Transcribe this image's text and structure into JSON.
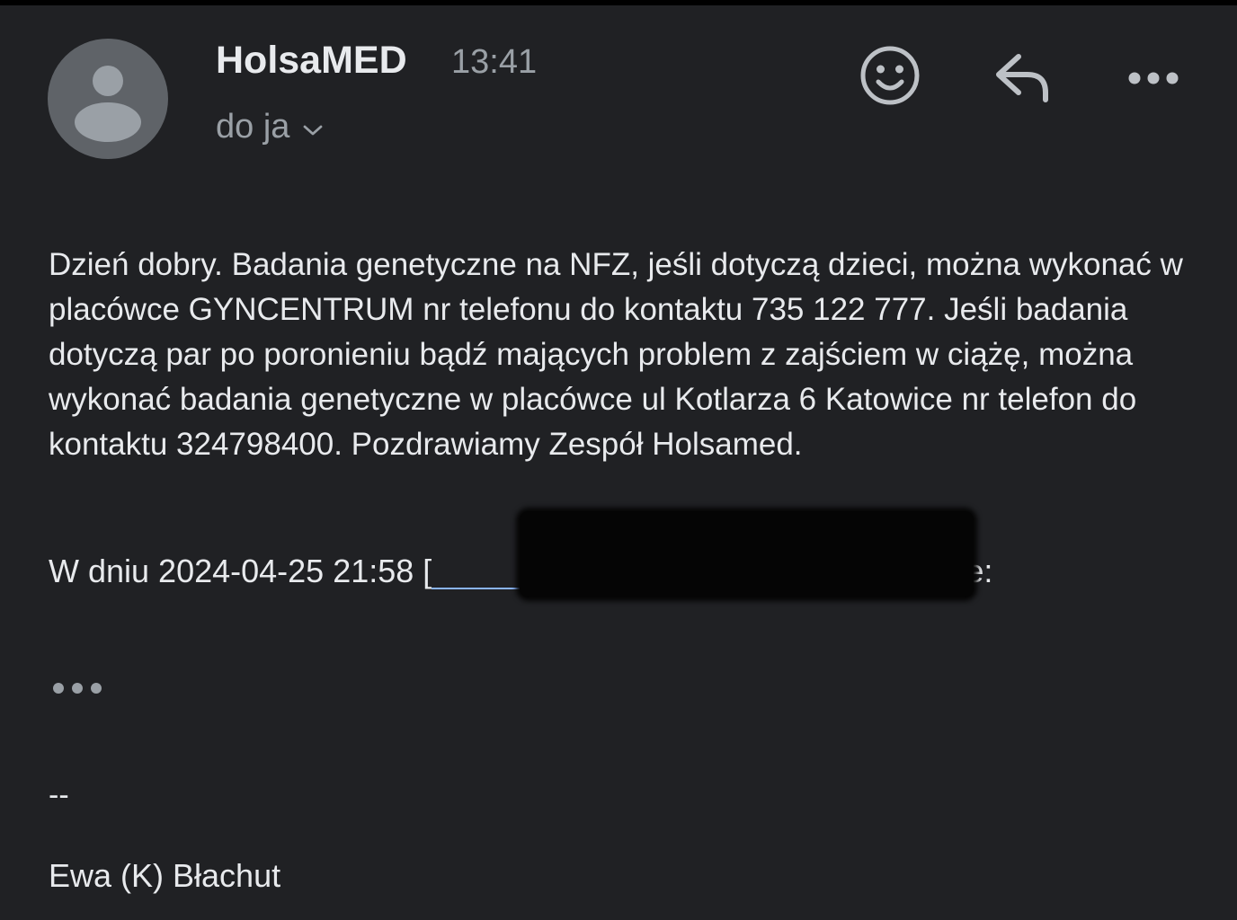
{
  "header": {
    "sender_name": "HolsaMED",
    "time": "13:41",
    "recipient": "do ja",
    "icons": {
      "avatar": "person-avatar-icon",
      "expand": "chevron-down-icon",
      "emoji": "emoji-reaction-icon",
      "reply": "reply-icon",
      "more": "more-horizontal-icon"
    }
  },
  "message": {
    "body": "Dzień dobry. Badania genetyczne na NFZ, jeśli dotyczą dzieci, można wykonać w placówce GYNCENTRUM nr telefonu do kontaktu 735 122 777. Jeśli badania dotyczą par po poronieniu bądź mających problem z zajściem w ciążę, można wykonać badania genetyczne w placówce ul Kotlarza 6 Katowice nr telefon do kontaktu 324798400. Pozdrawiamy Zespół Holsamed.",
    "quote_prefix": "W dniu 2024-04-25 21:58 [",
    "quote_suffix": "], pisze:",
    "signature_separator": "--",
    "signature_name": "Ewa (K) Błachut"
  },
  "colors": {
    "background": "#202124",
    "text": "#e8eaed",
    "muted": "#9aa0a6",
    "avatar": "#5f6368",
    "link": "#8ab4f8"
  }
}
